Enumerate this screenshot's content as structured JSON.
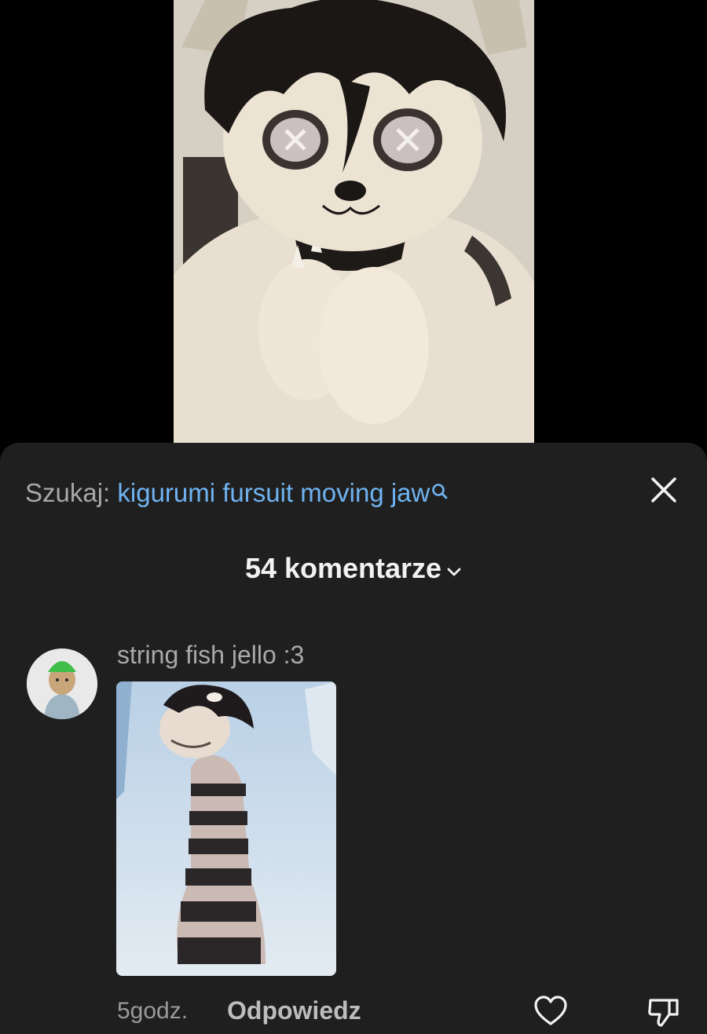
{
  "video": {
    "icon": "fursuit-video-thumbnail"
  },
  "search": {
    "prefix": "Szukaj:",
    "query": "kigurumi fursuit moving jaw",
    "icon": "search-icon"
  },
  "close": {
    "icon": "close-icon"
  },
  "comments": {
    "count_label": "54 komentarze",
    "icon": "chevron-down-icon"
  },
  "comment": {
    "author": "string fish jello :3",
    "time": "5godz.",
    "reply_label": "Odpowiedz",
    "like_icon": "heart-icon",
    "dislike_icon": "thumbs-down-icon"
  },
  "colors": {
    "sheet_bg": "#1f1f1f",
    "link": "#6fb3f2",
    "muted": "#a8a8a8",
    "text": "#f2f2f2"
  }
}
